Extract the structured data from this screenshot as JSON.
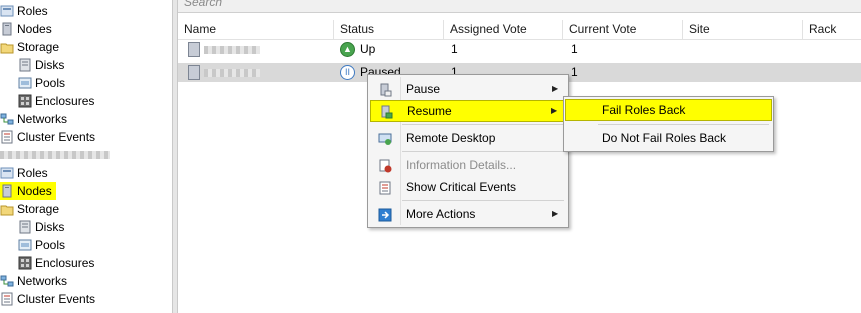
{
  "tree": {
    "items": [
      {
        "label": "Roles",
        "icon": "roles-icon"
      },
      {
        "label": "Nodes",
        "icon": "nodes-icon"
      },
      {
        "label": "Storage",
        "icon": "storage-icon"
      },
      {
        "label": "Disks",
        "icon": "disks-icon"
      },
      {
        "label": "Pools",
        "icon": "pools-icon"
      },
      {
        "label": "Enclosures",
        "icon": "enclosures-icon"
      },
      {
        "label": "Networks",
        "icon": "networks-icon"
      },
      {
        "label": "Cluster Events",
        "icon": "cluster-events-icon"
      },
      {
        "label": "",
        "icon": "cluster-icon"
      },
      {
        "label": "Roles",
        "icon": "roles-icon"
      },
      {
        "label": "Nodes",
        "icon": "nodes-icon"
      },
      {
        "label": "Storage",
        "icon": "storage-icon"
      },
      {
        "label": "Disks",
        "icon": "disks-icon"
      },
      {
        "label": "Pools",
        "icon": "pools-icon"
      },
      {
        "label": "Enclosures",
        "icon": "enclosures-icon"
      },
      {
        "label": "Networks",
        "icon": "networks-icon"
      },
      {
        "label": "Cluster Events",
        "icon": "cluster-events-icon"
      }
    ]
  },
  "search": {
    "placeholder": "Search"
  },
  "table": {
    "columns": [
      "Name",
      "Status",
      "Assigned Vote",
      "Current Vote",
      "Site",
      "Rack"
    ],
    "rows": [
      {
        "name": "",
        "status": "Up",
        "assigned_vote": "1",
        "current_vote": "1"
      },
      {
        "name": "",
        "status": "Paused",
        "assigned_vote": "1",
        "current_vote": "1"
      }
    ]
  },
  "context_menu": {
    "items": [
      {
        "label": "Pause",
        "icon": "pause-node-icon"
      },
      {
        "label": "Resume",
        "icon": "resume-node-icon"
      },
      {
        "label": "Remote Desktop",
        "icon": "remote-desktop-icon"
      },
      {
        "label": "Information Details...",
        "icon": "information-details-icon"
      },
      {
        "label": "Show Critical Events",
        "icon": "critical-events-icon"
      },
      {
        "label": "More Actions",
        "icon": "more-actions-icon"
      }
    ]
  },
  "submenu": {
    "items": [
      {
        "label": "Fail Roles Back"
      },
      {
        "label": "Do Not Fail Roles Back"
      }
    ]
  },
  "colors": {
    "highlight": "#ffff00",
    "selected_row": "#d9d9d9",
    "menu_bg": "#f5f5f5"
  }
}
